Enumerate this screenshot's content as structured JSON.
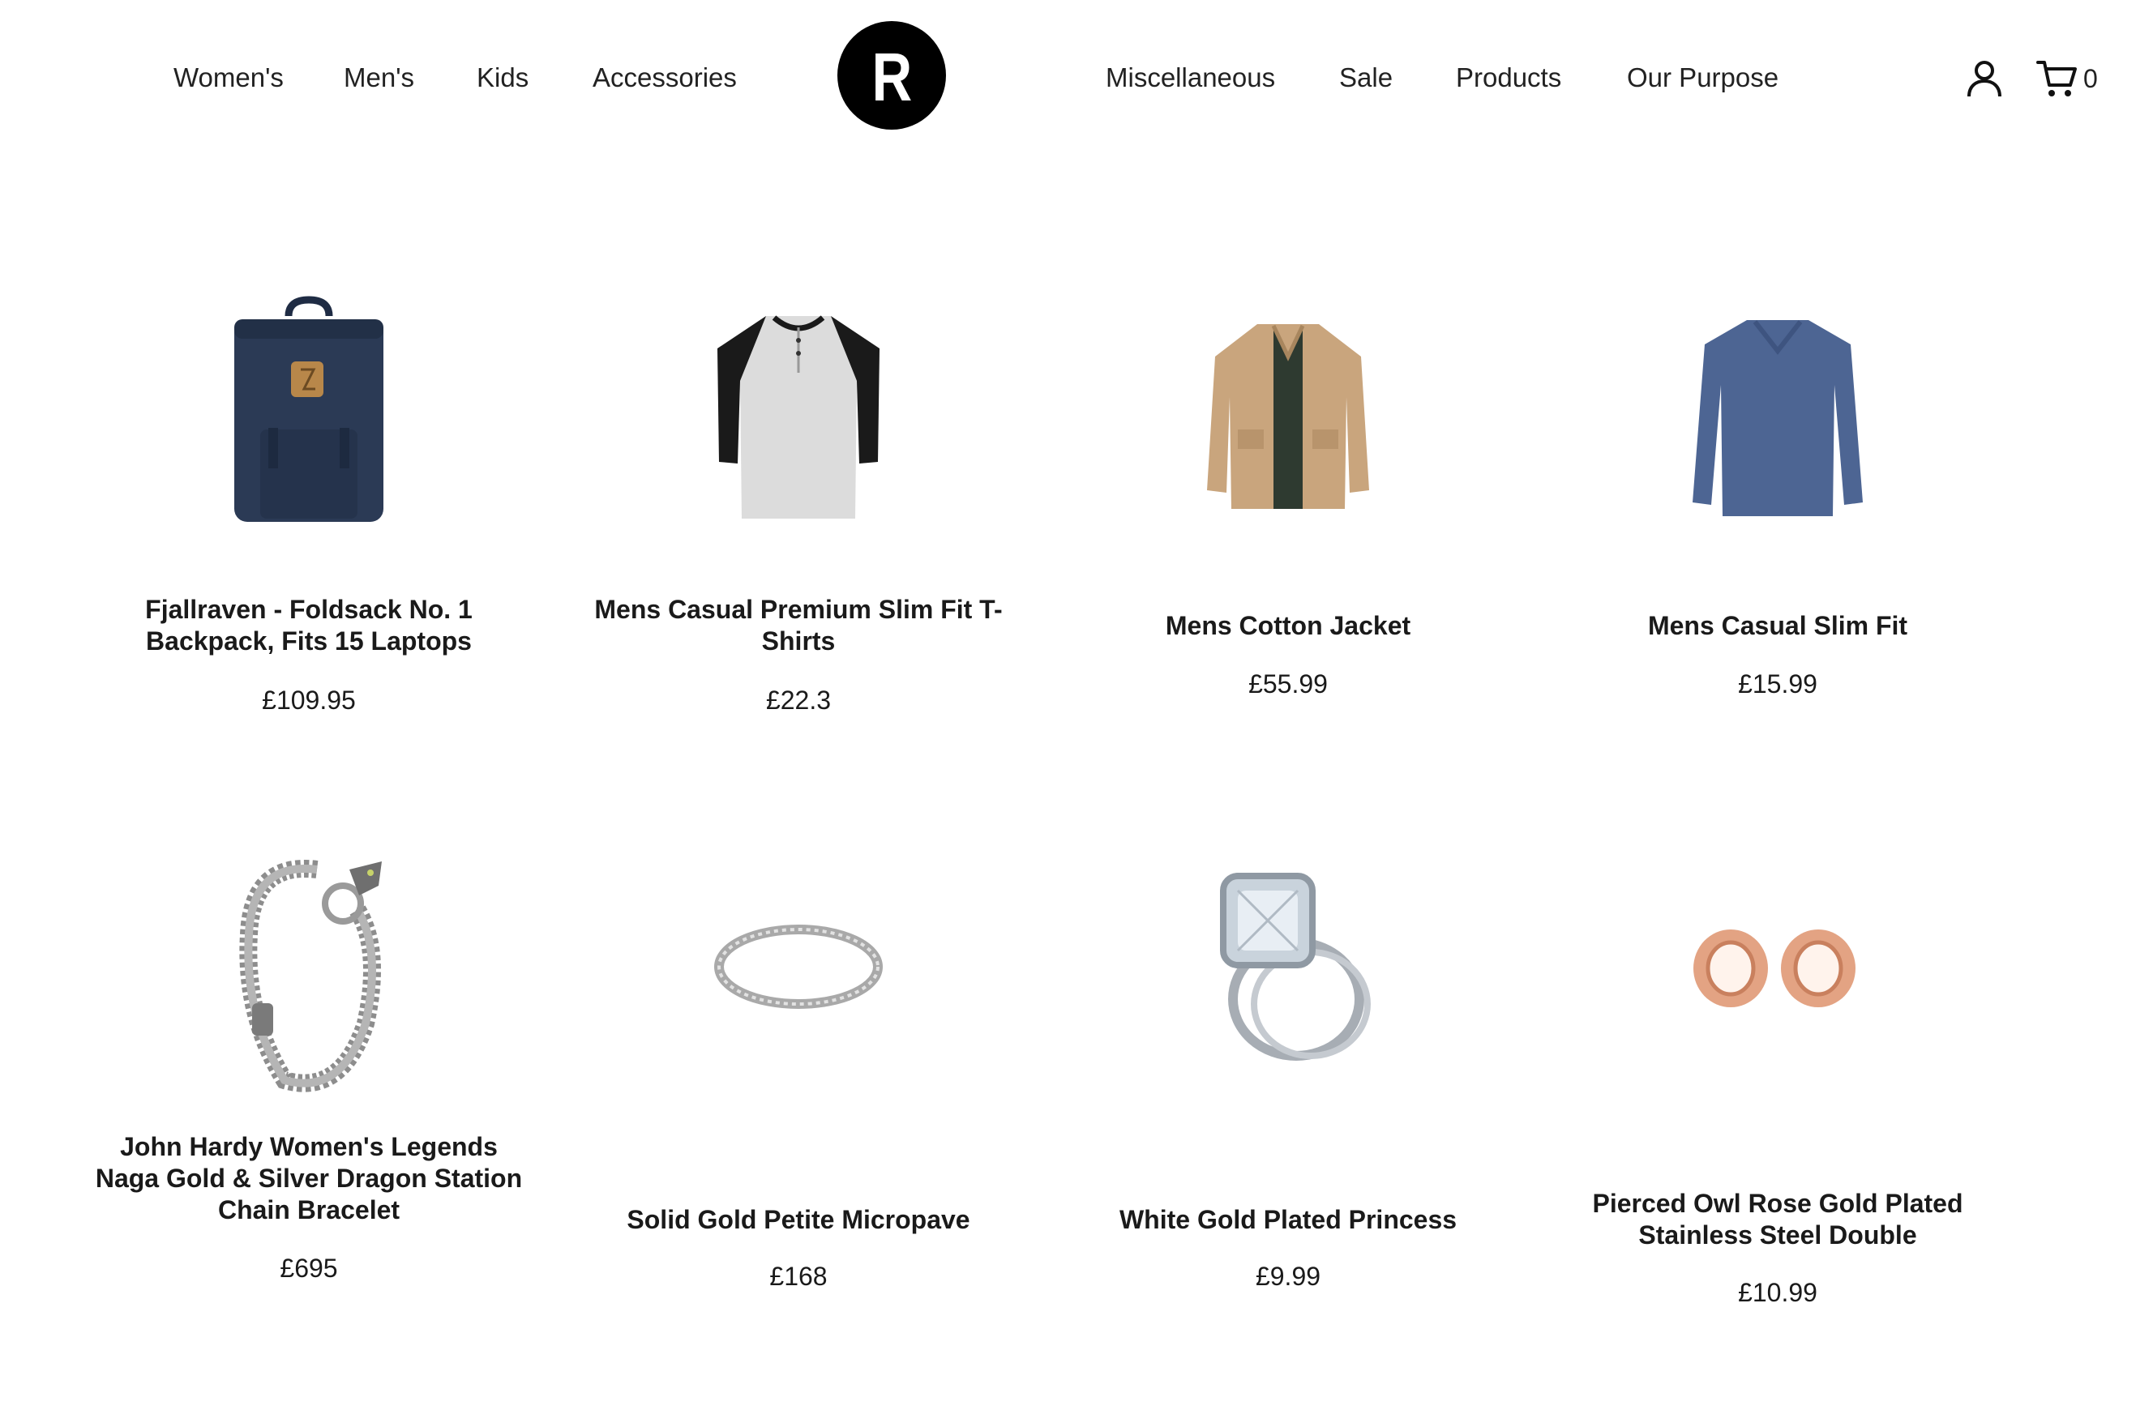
{
  "nav": {
    "left": [
      "Women's",
      "Men's",
      "Kids",
      "Accessories"
    ],
    "right": [
      "Miscellaneous",
      "Sale",
      "Products",
      "Our Purpose"
    ],
    "logo_letter": "R",
    "cart_count": "0"
  },
  "products": [
    {
      "title": "Fjallraven - Foldsack No. 1 Backpack, Fits 15 Laptops",
      "price": "£109.95",
      "icon": "backpack-icon"
    },
    {
      "title": "Mens Casual Premium Slim Fit T-Shirts",
      "price": "£22.3",
      "icon": "tshirt-icon"
    },
    {
      "title": "Mens Cotton Jacket",
      "price": "£55.99",
      "icon": "jacket-icon"
    },
    {
      "title": "Mens Casual Slim Fit",
      "price": "£15.99",
      "icon": "sweater-icon"
    },
    {
      "title": "John Hardy Women's Legends Naga Gold & Silver Dragon Station Chain Bracelet",
      "price": "£695",
      "icon": "bracelet-icon"
    },
    {
      "title": "Solid Gold Petite Micropave",
      "price": "£168",
      "icon": "ring-icon"
    },
    {
      "title": "White Gold Plated Princess",
      "price": "£9.99",
      "icon": "engagement-ring-icon"
    },
    {
      "title": "Pierced Owl Rose Gold Plated Stainless Steel Double",
      "price": "£10.99",
      "icon": "ear-tunnel-icon"
    }
  ],
  "colors": {
    "text": "#1a1a1a",
    "logo_bg": "#000000",
    "backpack": "#2b3a55",
    "jacket": "#c9a57d",
    "sweater": "#4d6593",
    "rose_gold": "#e3a383"
  }
}
